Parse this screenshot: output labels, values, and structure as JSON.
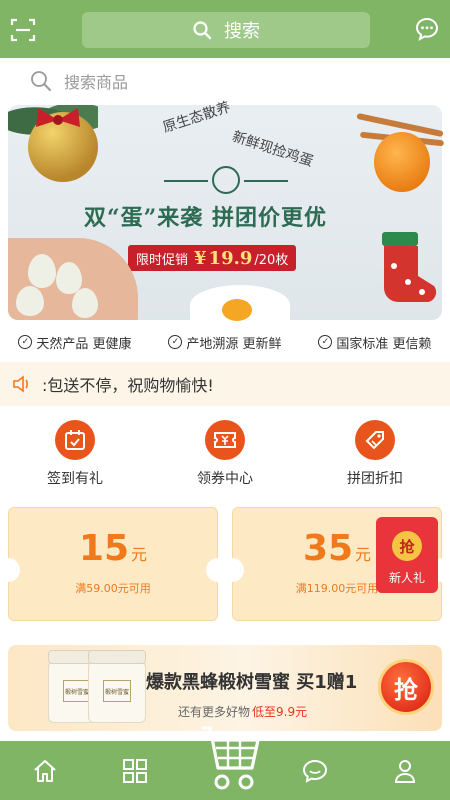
{
  "header": {
    "search_label": "搜索"
  },
  "search_bar": {
    "placeholder": "搜索商品"
  },
  "banner": {
    "subtitle_left": "原生态散养",
    "subtitle_right": "新鲜现捡鸡蛋",
    "title": "双“蛋”来袭 拼团价更优",
    "promo_label": "限时促销",
    "promo_currency": "¥",
    "promo_price": "19.9",
    "promo_unit": "/20枚"
  },
  "features": [
    {
      "label": "天然产品 更健康"
    },
    {
      "label": "产地溯源 更新鲜"
    },
    {
      "label": "国家标准 更信赖"
    }
  ],
  "notice": {
    "text": ":包送不停，祝购物愉快!"
  },
  "actions": [
    {
      "label": "签到有礼",
      "icon": "calendar-check-icon"
    },
    {
      "label": "领券中心",
      "icon": "coupon-ticket-icon"
    },
    {
      "label": "拼团折扣",
      "icon": "group-tag-icon"
    }
  ],
  "coupons": [
    {
      "amount": "15",
      "unit": "元",
      "condition": "满59.00元可用"
    },
    {
      "amount": "35",
      "unit": "元",
      "condition": "满119.00元可用"
    }
  ],
  "newbie_badge": {
    "grab": "抢",
    "label": "新人礼"
  },
  "product_banner": {
    "title": "爆款黑蜂椴树雪蜜 买1赠1",
    "sub_text": "还有更多好物",
    "sub_highlight": "低至9.9元",
    "grab": "抢",
    "jar_label": "椴树雪蜜"
  },
  "bottom_nav": [
    {
      "icon": "home-icon"
    },
    {
      "icon": "grid-category-icon"
    },
    {
      "icon": "cart-icon"
    },
    {
      "icon": "message-icon"
    },
    {
      "icon": "user-icon"
    }
  ],
  "colors": {
    "primary_green": "#7fb565",
    "accent_orange": "#e9541c",
    "coupon_bg": "#fde9c4",
    "coupon_text": "#f07a1b",
    "promo_red": "#c8202a"
  }
}
